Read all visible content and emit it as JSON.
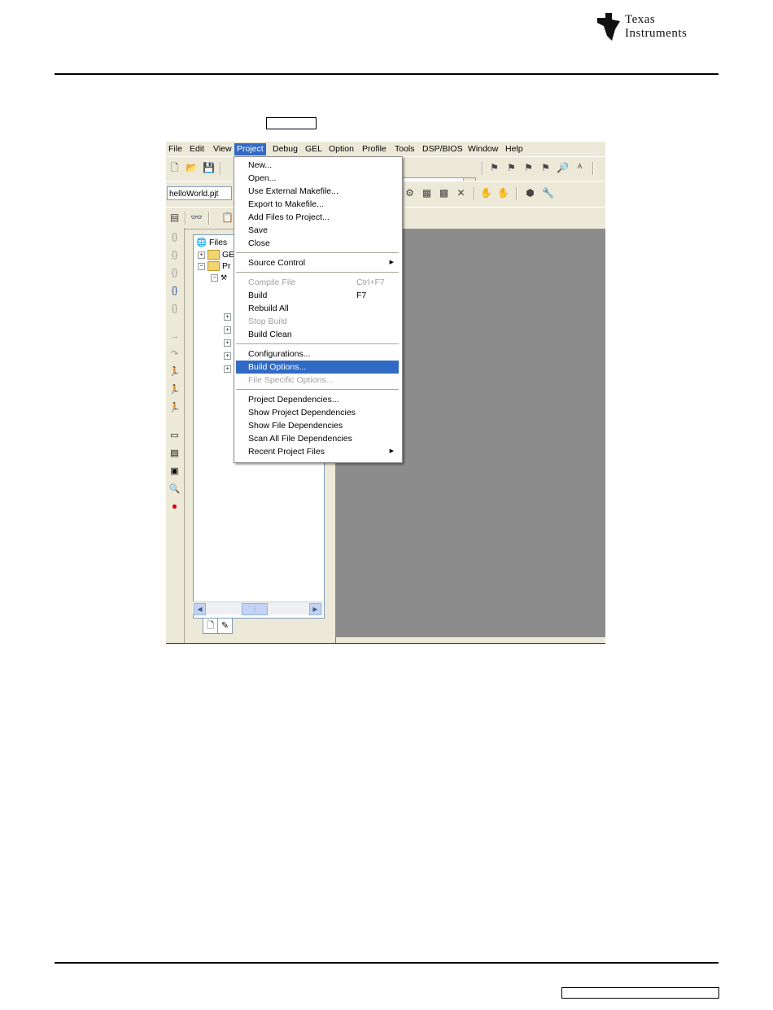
{
  "brand": {
    "logo_line1": "Texas",
    "logo_line2": "Instruments"
  },
  "menubar": {
    "items": [
      "File",
      "Edit",
      "View",
      "Project",
      "Debug",
      "GEL",
      "Option",
      "Profile",
      "Tools",
      "DSP/BIOS",
      "Window",
      "Help"
    ],
    "active": "Project"
  },
  "toolbar": {
    "project_combo_value": "helloWorld.pjt"
  },
  "tree": {
    "root_label": "Files",
    "gel_label": "GE",
    "projects_label": "Pr"
  },
  "project_menu": {
    "items": [
      {
        "label": "New...",
        "state": "enabled"
      },
      {
        "label": "Open...",
        "state": "enabled"
      },
      {
        "label": "Use External Makefile...",
        "state": "enabled"
      },
      {
        "label": "Export to Makefile...",
        "state": "enabled"
      },
      {
        "label": "Add Files to Project...",
        "state": "enabled"
      },
      {
        "label": "Save",
        "state": "enabled"
      },
      {
        "label": "Close",
        "state": "enabled"
      },
      {
        "label": "Source Control",
        "state": "enabled",
        "submenu": true
      },
      {
        "label": "Compile File",
        "state": "disabled",
        "shortcut": "Ctrl+F7"
      },
      {
        "label": "Build",
        "state": "enabled",
        "shortcut": "F7"
      },
      {
        "label": "Rebuild All",
        "state": "enabled"
      },
      {
        "label": "Stop Build",
        "state": "disabled"
      },
      {
        "label": "Build Clean",
        "state": "enabled"
      },
      {
        "label": "Configurations...",
        "state": "enabled"
      },
      {
        "label": "Build Options...",
        "state": "highlighted"
      },
      {
        "label": "File Specific Options...",
        "state": "disabled"
      },
      {
        "label": "Project Dependencies...",
        "state": "enabled"
      },
      {
        "label": "Show Project Dependencies",
        "state": "enabled"
      },
      {
        "label": "Show File Dependencies",
        "state": "enabled"
      },
      {
        "label": "Scan All File Dependencies",
        "state": "enabled"
      },
      {
        "label": "Recent Project Files",
        "state": "enabled",
        "submenu": true
      }
    ]
  },
  "colors": {
    "highlight": "#316ac5",
    "window_bg": "#ece9d8",
    "workspace": "#8c8c8c"
  }
}
